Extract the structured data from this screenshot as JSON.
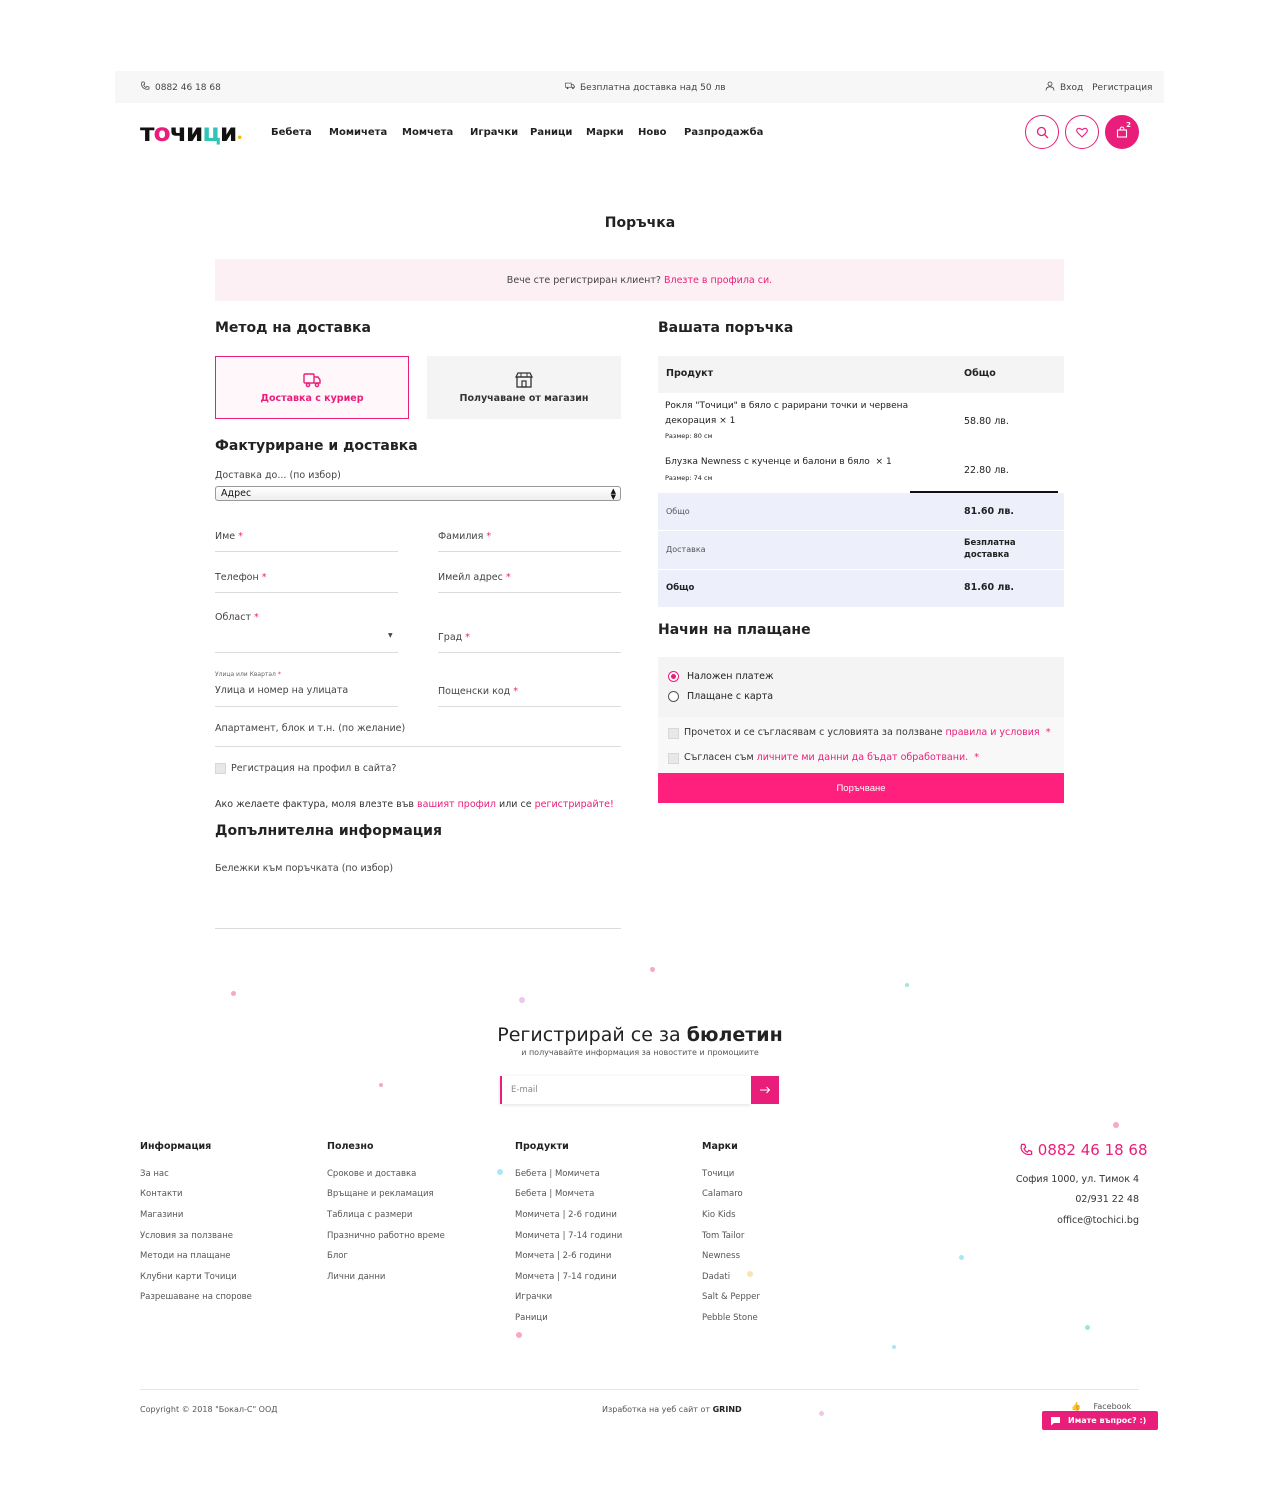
{
  "topbar": {
    "phone": "0882 46 18 68",
    "delivery_note": "Безплатна доставка над 50 лв",
    "login": "Вход",
    "register": "Регистрация"
  },
  "nav": {
    "logo": "ТОЧИЦИ",
    "items": [
      "Бебета",
      "Момичета",
      "Момчета",
      "Играчки",
      "Раници",
      "Марки",
      "Ново",
      "Разпродажба"
    ],
    "cart_count": "2"
  },
  "page": {
    "title": "Поръчка",
    "notice_text": "Вече сте регистриран клиент?",
    "notice_link": "Влезте в профила си."
  },
  "shipping": {
    "title": "Метод на доставка",
    "courier": "Доставка с куриер",
    "pickup": "Получаване от магазин"
  },
  "billing": {
    "title": "Фактуриране и доставка",
    "delivery_to_label": "Доставка до... (по избор)",
    "delivery_to_value": "Адрес",
    "first_name": "Име",
    "last_name": "Фамилия",
    "phone": "Телефон",
    "email": "Имейл адрес",
    "region": "Област",
    "city": "Град",
    "street_small": "Улица или Квартал",
    "street_placeholder": "Улица и номер на улицата",
    "postcode": "Пощенски код",
    "apartment": "Апартамент, блок и т.н. (по желание)",
    "register_checkbox": "Регистрация на профил в сайта?",
    "invoice_text_1": "Ако желаете фактура, моля влезте във",
    "invoice_link_1": "вашият профил",
    "invoice_text_2": "или се",
    "invoice_link_2": "регистрирайте!"
  },
  "additional": {
    "title": "Допълнителна информация",
    "notes_label": "Бележки към поръчката (по избор)"
  },
  "order": {
    "title": "Вашата поръчка",
    "col_product": "Продукт",
    "col_total": "Общо",
    "items": [
      {
        "name": "Рокля \"Точици\" в бяло с рарирани точки и червена",
        "name2": "декорация",
        "qty": "× 1",
        "size": "Размер: 80 см",
        "price": "58.80 лв."
      },
      {
        "name": "Блузка Newness с кученце и балони в бяло",
        "qty": "× 1",
        "size": "Размер: 74 см",
        "price": "22.80 лв."
      }
    ],
    "subtotal_label": "Общо",
    "subtotal": "81.60 лв.",
    "shipping_label": "Доставка",
    "shipping_value_1": "Безплатна",
    "shipping_value_2": "доставка",
    "total_label": "Общо",
    "total": "81.60 лв."
  },
  "payment": {
    "title": "Начин на плащане",
    "cod": "Наложен платеж",
    "card": "Плащане с карта",
    "terms_text": "Прочетох и се съгласявам с условията за ползване",
    "terms_link": "правила и условия",
    "privacy_text": "Съгласен съм",
    "privacy_link": "личните ми данни да бъдат обработвани.",
    "button": "Поръчване"
  },
  "newsletter": {
    "title_1": "Регистрирай се за",
    "title_2": "бюлетин",
    "subtitle": "и получавайте информация за новостите и промоциите",
    "placeholder": "E-mail"
  },
  "footer": {
    "columns": [
      {
        "title": "Информация",
        "links": [
          "За нас",
          "Контакти",
          "Магазини",
          "Условия за ползване",
          "Методи на плащане",
          "Клубни карти Точици",
          "Разрешаване на спорове"
        ]
      },
      {
        "title": "Полезно",
        "links": [
          "Срокове и доставка",
          "Връщане и рекламация",
          "Таблица с размери",
          "Празнично работно време",
          "Блог",
          "Лични данни"
        ]
      },
      {
        "title": "Продукти",
        "links": [
          "Бебета | Момичета",
          "Бебета | Момчета",
          "Момичета | 2-6 години",
          "Момичета | 7-14 години",
          "Момчета | 2-6 години",
          "Момчета | 7-14 години",
          "Играчки",
          "Раници"
        ]
      },
      {
        "title": "Марки",
        "links": [
          "Точици",
          "Calamaro",
          "Kio Kids",
          "Tom Tailor",
          "Newness",
          "Dadati",
          "Salt & Pepper",
          "Pebble Stone"
        ]
      }
    ],
    "contact_phone": "0882 46 18 68",
    "address": "София 1000, ул. Тимок 4",
    "landline": "02/931 22 48",
    "email": "office@tochici.bg",
    "copyright": "Copyright © 2018 \"Бокал-С\" ООД",
    "made_by_text": "Изработка на уеб сайт от",
    "made_by_brand": "GRIND",
    "facebook": "Facebook",
    "chat": "Имате въпрос? :)"
  },
  "colors": {
    "accent": "#e91e7a",
    "button": "#ff1f7d",
    "summary_bg": "#edf0fb"
  }
}
